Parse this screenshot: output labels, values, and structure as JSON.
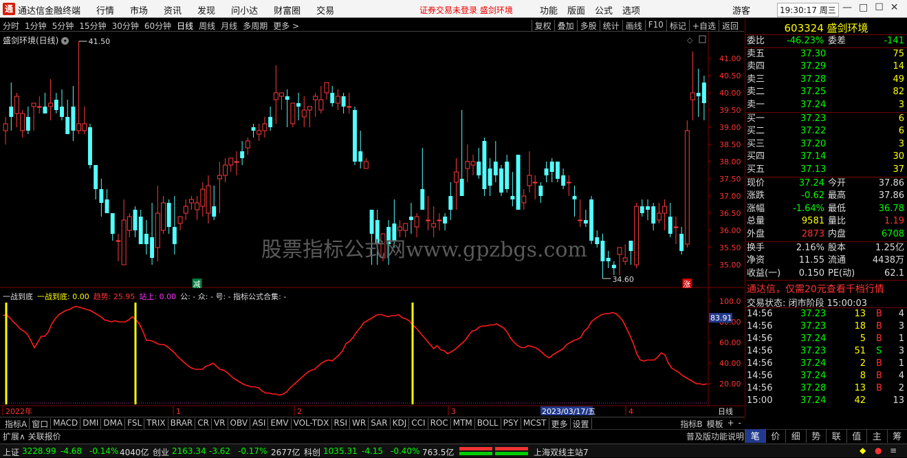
{
  "app": {
    "logo": "通",
    "title": "通达信金融终端",
    "menus": [
      "行情",
      "市场",
      "资讯",
      "发现",
      "问小达",
      "财富圈",
      "交易"
    ],
    "notice": "证券交易未登录  盛剑环境",
    "right_menus": [
      "功能",
      "版面",
      "公式",
      "选项"
    ],
    "guest": "游客",
    "clock": "19:30:17 周三",
    "controls": [
      "—",
      "□",
      "☐",
      "✕"
    ]
  },
  "period_bar": {
    "items": [
      "分时",
      "1分钟",
      "5分钟",
      "15分钟",
      "30分钟",
      "60分钟",
      "日线",
      "周线",
      "月线",
      "多周期",
      "更多 >"
    ],
    "active": "日线",
    "right_buttons": [
      "复权",
      "叠加",
      "多股",
      "统计",
      "画线",
      "F10",
      "标记",
      "+自选",
      "返回"
    ]
  },
  "stock_name": "盛剑环境(日线)",
  "price_axis": [
    "41.00",
    "40.50",
    "40.00",
    "39.50",
    "39.00",
    "38.50",
    "38.00",
    "37.50",
    "37.00",
    "36.50",
    "36.00",
    "35.50",
    "35.00"
  ],
  "annotations": {
    "high": "41.50",
    "low": "34.60",
    "jian": "减",
    "zhang": "涨",
    "watermark": "股票指标公式网www.gpzbgs.com"
  },
  "sub_indicator": {
    "parts": [
      {
        "text": "一战到底",
        "color": "#dddddd"
      },
      {
        "text": "一战到底: 0.00",
        "color": "#ffff00"
      },
      {
        "text": "趋势: 25.95",
        "color": "#ff3333"
      },
      {
        "text": "站上: 0.00",
        "color": "#ff33ff"
      },
      {
        "text": "公: - 众: - 号: - 指标公式合集: -",
        "color": "#dddddd"
      }
    ],
    "axis": [
      "100.0",
      "80.00",
      "60.00",
      "40.00",
      "20.00"
    ],
    "current": "83.91"
  },
  "x_axis": {
    "labels": [
      "2022年",
      "1",
      "2",
      "3",
      "4"
    ],
    "date_label": "2023/03/17/五",
    "period": "日线"
  },
  "chart_data": {
    "type": "candlestick",
    "ylim": [
      34.6,
      41.5
    ],
    "candles": [
      [
        38.9,
        39.3,
        38.5,
        39.1
      ],
      [
        39.6,
        40.3,
        38.9,
        39.3
      ],
      [
        39.4,
        40.0,
        39.0,
        39.9
      ],
      [
        38.9,
        39.5,
        38.7,
        39.4
      ],
      [
        39.3,
        39.6,
        38.8,
        38.9
      ],
      [
        39.6,
        39.7,
        38.9,
        39.7
      ],
      [
        39.6,
        39.9,
        39.4,
        39.6
      ],
      [
        39.6,
        40.0,
        39.4,
        39.4
      ],
      [
        39.6,
        40.4,
        39.2,
        39.7
      ],
      [
        39.8,
        40.0,
        39.4,
        39.5
      ],
      [
        39.6,
        40.1,
        39.2,
        39.3
      ],
      [
        39.3,
        39.8,
        38.8,
        38.8
      ],
      [
        39.6,
        40.2,
        38.6,
        38.9
      ],
      [
        38.9,
        41.5,
        38.8,
        39.1
      ],
      [
        38.9,
        39.6,
        38.8,
        39.1
      ],
      [
        39.0,
        39.1,
        37.8,
        37.9
      ],
      [
        37.9,
        37.9,
        36.9,
        37.2
      ],
      [
        37.2,
        37.5,
        36.4,
        36.8
      ],
      [
        36.9,
        37.2,
        36.5,
        36.5
      ],
      [
        36.5,
        36.5,
        35.7,
        35.9
      ],
      [
        35.7,
        35.9,
        35.1,
        35.7
      ],
      [
        35.0,
        36.9,
        35.0,
        36.3
      ],
      [
        36.0,
        36.5,
        35.8,
        36.4
      ],
      [
        36.6,
        36.7,
        35.8,
        36.0
      ],
      [
        36.4,
        36.6,
        35.6,
        35.6
      ],
      [
        35.9,
        36.3,
        35.3,
        35.6
      ],
      [
        35.8,
        36.8,
        35.0,
        35.2
      ],
      [
        35.5,
        37.3,
        35.1,
        36.5
      ],
      [
        36.0,
        37.0,
        35.9,
        36.8
      ],
      [
        36.8,
        36.9,
        35.9,
        36.1
      ],
      [
        36.1,
        37.0,
        35.3,
        35.6
      ],
      [
        36.2,
        36.4,
        36.0,
        36.4
      ],
      [
        36.5,
        36.9,
        36.3,
        36.7
      ],
      [
        36.8,
        37.0,
        36.6,
        36.9
      ],
      [
        36.6,
        37.0,
        36.3,
        36.8
      ],
      [
        36.7,
        37.4,
        36.4,
        37.2
      ],
      [
        36.5,
        37.6,
        36.2,
        37.3
      ],
      [
        36.7,
        37.3,
        36.3,
        36.4
      ],
      [
        37.5,
        38.0,
        36.5,
        37.6
      ],
      [
        37.6,
        38.1,
        37.4,
        37.9
      ],
      [
        37.9,
        38.1,
        37.7,
        38.1
      ],
      [
        38.0,
        38.3,
        37.6,
        38.0
      ],
      [
        38.3,
        38.6,
        37.9,
        38.1
      ],
      [
        38.4,
        38.7,
        38.2,
        38.6
      ],
      [
        39.0,
        39.1,
        38.7,
        38.9
      ],
      [
        38.8,
        39.1,
        38.6,
        38.9
      ],
      [
        38.9,
        39.3,
        38.7,
        39.1
      ],
      [
        39.3,
        39.6,
        38.9,
        39.0
      ],
      [
        39.8,
        40.8,
        39.1,
        40.0
      ],
      [
        39.9,
        40.0,
        39.5,
        40.0
      ],
      [
        39.9,
        40.1,
        39.0,
        39.8
      ],
      [
        39.1,
        39.7,
        39.0,
        39.7
      ],
      [
        39.7,
        40.0,
        39.2,
        39.6
      ],
      [
        39.3,
        39.9,
        39.0,
        39.5
      ],
      [
        39.5,
        39.6,
        39.0,
        39.6
      ],
      [
        39.8,
        40.0,
        39.3,
        39.9
      ],
      [
        39.5,
        40.2,
        39.4,
        39.8
      ],
      [
        40.0,
        40.3,
        39.8,
        40.3
      ],
      [
        40.0,
        40.2,
        39.6,
        39.7
      ],
      [
        39.7,
        40.1,
        39.5,
        39.9
      ],
      [
        39.9,
        40.0,
        39.4,
        39.6
      ],
      [
        39.6,
        40.0,
        39.4,
        39.6
      ],
      [
        39.5,
        39.6,
        37.9,
        38.0
      ],
      [
        38.3,
        38.9,
        37.8,
        38.0
      ],
      [
        37.8,
        38.1,
        37.9,
        38.0
      ],
      [
        36.6,
        36.6,
        35.0,
        35.9
      ],
      [
        36.3,
        36.6,
        35.0,
        35.6
      ],
      [
        35.2,
        35.9,
        35.1,
        35.9
      ],
      [
        36.1,
        36.3,
        35.0,
        35.6
      ],
      [
        36.2,
        36.9,
        35.5,
        35.7
      ],
      [
        36.0,
        36.3,
        35.8,
        36.1
      ],
      [
        36.0,
        36.2,
        35.8,
        36.2
      ],
      [
        36.4,
        36.8,
        35.9,
        36.3
      ],
      [
        36.1,
        36.5,
        35.8,
        36.4
      ],
      [
        37.2,
        38.4,
        36.6,
        36.6
      ],
      [
        36.3,
        37.0,
        36.0,
        36.3
      ],
      [
        36.1,
        36.7,
        35.8,
        36.2
      ],
      [
        36.3,
        36.5,
        36.0,
        36.3
      ],
      [
        36.4,
        36.5,
        36.0,
        36.2
      ],
      [
        37.0,
        37.4,
        36.3,
        36.6
      ],
      [
        37.4,
        38.1,
        36.6,
        37.7
      ],
      [
        37.5,
        39.5,
        37.0,
        37.0
      ],
      [
        37.8,
        38.5,
        37.4,
        38.0
      ],
      [
        37.9,
        38.2,
        37.6,
        38.0
      ],
      [
        38.0,
        38.4,
        37.5,
        37.6
      ],
      [
        38.6,
        38.7,
        37.0,
        37.2
      ],
      [
        37.8,
        38.1,
        37.0,
        37.3
      ],
      [
        38.0,
        38.6,
        37.4,
        37.6
      ],
      [
        37.8,
        37.9,
        37.0,
        37.1
      ],
      [
        38.0,
        38.2,
        37.1,
        37.2
      ],
      [
        37.0,
        37.7,
        36.7,
        36.9
      ],
      [
        38.2,
        38.2,
        36.6,
        36.6
      ],
      [
        36.8,
        37.2,
        36.6,
        37.0
      ],
      [
        37.3,
        38.3,
        37.1,
        37.6
      ],
      [
        37.4,
        37.6,
        36.9,
        37.4
      ],
      [
        37.3,
        37.4,
        36.8,
        37.0
      ],
      [
        37.8,
        38.0,
        37.4,
        37.6
      ],
      [
        38.0,
        38.1,
        37.4,
        37.7
      ],
      [
        38.0,
        38.0,
        37.4,
        37.5
      ],
      [
        37.6,
        37.8,
        37.2,
        37.3
      ],
      [
        37.4,
        37.6,
        37.0,
        37.4
      ],
      [
        37.0,
        37.3,
        36.4,
        36.9
      ],
      [
        36.3,
        36.9,
        36.1,
        36.3
      ],
      [
        36.3,
        36.6,
        36.1,
        36.2
      ],
      [
        36.9,
        37.0,
        35.6,
        35.7
      ],
      [
        35.8,
        36.0,
        35.5,
        35.6
      ],
      [
        35.7,
        35.9,
        34.6,
        35.1
      ],
      [
        35.2,
        35.4,
        34.9,
        35.1
      ],
      [
        35.0,
        35.1,
        34.7,
        34.9
      ],
      [
        35.3,
        35.5,
        34.7,
        35.5
      ],
      [
        35.1,
        35.6,
        35.0,
        35.2
      ],
      [
        35.7,
        35.7,
        35.0,
        35.4
      ],
      [
        35.0,
        36.8,
        34.9,
        36.7
      ],
      [
        36.7,
        36.9,
        36.4,
        36.5
      ],
      [
        36.7,
        36.9,
        36.3,
        36.6
      ],
      [
        36.7,
        36.8,
        36.0,
        36.2
      ],
      [
        36.3,
        36.8,
        36.2,
        36.5
      ],
      [
        36.5,
        36.9,
        36.0,
        36.7
      ],
      [
        36.4,
        36.8,
        35.8,
        35.9
      ],
      [
        36.1,
        36.4,
        35.6,
        36.1
      ],
      [
        35.9,
        36.1,
        35.3,
        35.4
      ],
      [
        35.6,
        39.2,
        35.5,
        38.9
      ],
      [
        39.8,
        41.2,
        39.2,
        40.0
      ],
      [
        40.0,
        40.7,
        39.3,
        39.9
      ],
      [
        40.3,
        40.5,
        39.2,
        39.7
      ]
    ],
    "subline": [
      86,
      87,
      84,
      80,
      77,
      73,
      71,
      68,
      62,
      55,
      60,
      66,
      66,
      70,
      78,
      83,
      87,
      89,
      91,
      92,
      94,
      95,
      94,
      93,
      92,
      91,
      89,
      87,
      85,
      82,
      81,
      80,
      81,
      80,
      80,
      80,
      82,
      85,
      82,
      78,
      71,
      62,
      62,
      61,
      59,
      58,
      58,
      56,
      53,
      50,
      46,
      43,
      40,
      37,
      35,
      34,
      34,
      34,
      37,
      38,
      40,
      37,
      34,
      33,
      31,
      28,
      25,
      23,
      21,
      19,
      18,
      17,
      17,
      16,
      13,
      11,
      11,
      10,
      10,
      9,
      10,
      12,
      16,
      19,
      22,
      25,
      28,
      31,
      33,
      34,
      37,
      40,
      42,
      43,
      42,
      45,
      48,
      52,
      59,
      61,
      65,
      70,
      74,
      79,
      81,
      83,
      85,
      87,
      87,
      86,
      85,
      86,
      86,
      87,
      84,
      83,
      81,
      77,
      74,
      70,
      66,
      62,
      58,
      54,
      57,
      53,
      52,
      49,
      51,
      53,
      56,
      59,
      62,
      67,
      71,
      72,
      75,
      76,
      76,
      77,
      77,
      78,
      76,
      74,
      70,
      64,
      60,
      57,
      55,
      55,
      57,
      56,
      55,
      53,
      50,
      47,
      45,
      48,
      50,
      52,
      54,
      58,
      60,
      62,
      63,
      65,
      71,
      74,
      80,
      83,
      85,
      87,
      88,
      88,
      89,
      88,
      85,
      81,
      74,
      67,
      59,
      49,
      43,
      42,
      43,
      43,
      43,
      46,
      50,
      48,
      40,
      35,
      33,
      31,
      28,
      26,
      24,
      22,
      20,
      20,
      19,
      20
    ]
  },
  "right_panel": {
    "title": "603324 盛剑环境",
    "wei": {
      "weibi_label": "委比",
      "weibi_value": "-46.23%",
      "weicha_label": "委差",
      "weicha_value": "-141"
    },
    "asks": [
      {
        "label": "卖五",
        "price": "37.30",
        "vol": "75"
      },
      {
        "label": "卖四",
        "price": "37.29",
        "vol": "14"
      },
      {
        "label": "卖三",
        "price": "37.28",
        "vol": "49"
      },
      {
        "label": "卖二",
        "price": "37.25",
        "vol": "82"
      },
      {
        "label": "卖一",
        "price": "37.24",
        "vol": "3"
      }
    ],
    "bids": [
      {
        "label": "买一",
        "price": "37.23",
        "vol": "6"
      },
      {
        "label": "买二",
        "price": "37.22",
        "vol": "6"
      },
      {
        "label": "买三",
        "price": "37.20",
        "vol": "3"
      },
      {
        "label": "买四",
        "price": "37.14",
        "vol": "30"
      },
      {
        "label": "买五",
        "price": "37.13",
        "vol": "37"
      }
    ],
    "quote": [
      {
        "l1": "现价",
        "v1": "37.24",
        "c1": "down",
        "l2": "今开",
        "v2": "37.86",
        "c2": "white"
      },
      {
        "l1": "涨跌",
        "v1": "-0.62",
        "c1": "down",
        "l2": "最高",
        "v2": "37.86",
        "c2": "white"
      },
      {
        "l1": "涨幅",
        "v1": "-1.64%",
        "c1": "down",
        "l2": "最低",
        "v2": "36.78",
        "c2": "down"
      },
      {
        "l1": "总量",
        "v1": "9581",
        "c1": "yel",
        "l2": "量比",
        "v2": "1.19",
        "c2": "up"
      },
      {
        "l1": "外盘",
        "v1": "2873",
        "c1": "up",
        "l2": "内盘",
        "v2": "6708",
        "c2": "down"
      }
    ],
    "stats": [
      {
        "l1": "换手",
        "v1": "2.16%",
        "l2": "股本",
        "v2": "1.25亿"
      },
      {
        "l1": "净资",
        "v1": "11.55",
        "l2": "流通",
        "v2": "4438万"
      },
      {
        "l1": "收益(一)",
        "v1": "0.150",
        "l2": "PE(动)",
        "v2": "62.1"
      }
    ],
    "ad": "通达信，仅需20元查看千档行情",
    "status": "交易状态: 闭市阶段 15:00:03",
    "ticks": [
      {
        "t": "14:56",
        "p": "37.23",
        "v": "13",
        "bs": "B",
        "n": "4"
      },
      {
        "t": "14:56",
        "p": "37.23",
        "v": "18",
        "bs": "B",
        "n": "3"
      },
      {
        "t": "14:56",
        "p": "37.24",
        "v": "5",
        "bs": "B",
        "n": "1"
      },
      {
        "t": "14:56",
        "p": "37.23",
        "v": "51",
        "bs": "S",
        "n": "3"
      },
      {
        "t": "14:56",
        "p": "37.24",
        "v": "2",
        "bs": "B",
        "n": "1"
      },
      {
        "t": "14:56",
        "p": "37.24",
        "v": "8",
        "bs": "B",
        "n": "4"
      },
      {
        "t": "14:56",
        "p": "37.28",
        "v": "13",
        "bs": "B",
        "n": "2"
      },
      {
        "t": "15:00",
        "p": "37.24",
        "v": "42",
        "bs": "",
        "n": "13"
      }
    ]
  },
  "bottom_tabs": {
    "items": [
      "指标A",
      "窗口",
      "MACD",
      "DMI",
      "DMA",
      "FSL",
      "TRIX",
      "BRAR",
      "CR",
      "VR",
      "OBV",
      "ASI",
      "EMV",
      "VOL-TDX",
      "RSI",
      "WR",
      "SAR",
      "KDJ",
      "CCI",
      "ROC",
      "MTM",
      "BOLL",
      "PSY",
      "MCST",
      "更多",
      "设置"
    ],
    "right": [
      "指标B",
      "模板",
      "+",
      "-"
    ]
  },
  "bottom_sub": {
    "left": "扩展∧  关联报价",
    "right": "普及版功能说明"
  },
  "right_tabs": [
    "笔",
    "价",
    "细",
    "势",
    "联",
    "值",
    "主",
    "筹"
  ],
  "statusbar": {
    "sh_label": "上证",
    "sh_val": "3228.99",
    "sh_chg": "-4.68",
    "sh_pct": "-0.14%",
    "sh_amt": "4040亿",
    "cy_label": "创业",
    "cy_val": "2163.34",
    "cy_chg": "-3.62",
    "cy_pct": "-0.17%",
    "cy_amt": "2677亿",
    "kc_label": "科创",
    "kc_val": "1035.31",
    "kc_chg": "-4.15",
    "kc_pct": "-0.40%",
    "kc_amt": "763.5亿",
    "server": "上海双线主站7"
  }
}
